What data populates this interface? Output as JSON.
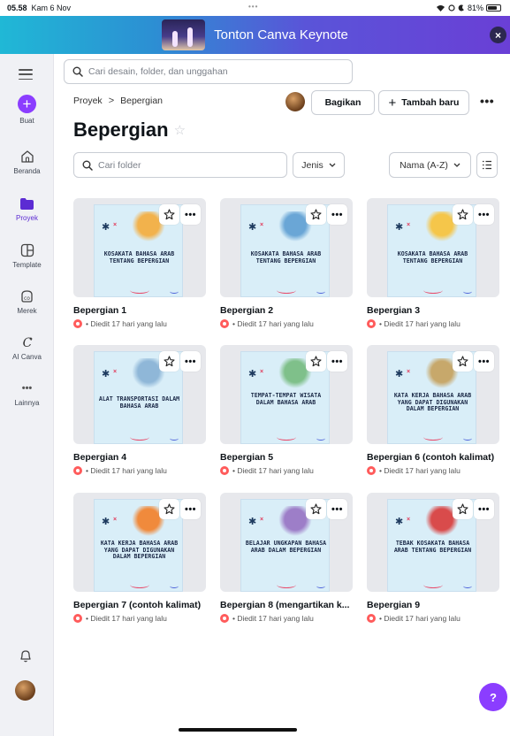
{
  "status": {
    "time": "05.58",
    "date": "Kam 6 Nov",
    "battery": "81%"
  },
  "banner": {
    "title": "Tonton Canva Keynote",
    "close": "×"
  },
  "sidebar": {
    "items": [
      {
        "label": "Buat"
      },
      {
        "label": "Beranda"
      },
      {
        "label": "Proyek"
      },
      {
        "label": "Template"
      },
      {
        "label": "Merek"
      },
      {
        "label": "AI Canva"
      },
      {
        "label": "Lainnya"
      }
    ]
  },
  "search": {
    "placeholder": "Cari desain, folder, dan unggahan"
  },
  "breadcrumb": {
    "root": "Proyek",
    "separator": ">",
    "current": "Bepergian"
  },
  "actions": {
    "share": "Bagikan",
    "new": "Tambah baru",
    "more": "•••"
  },
  "page": {
    "title": "Bepergian"
  },
  "filters": {
    "folder_search_placeholder": "Cari folder",
    "type": "Jenis",
    "sort": "Nama (A-Z)"
  },
  "cards": [
    {
      "name": "Bepergian 1",
      "meta": "• Diedit 17 hari yang lalu",
      "poster": "KOSAKATA BAHASA ARAB TENTANG BEPERGIAN"
    },
    {
      "name": "Bepergian 2",
      "meta": "• Diedit 17 hari yang lalu",
      "poster": "KOSAKATA BAHASA ARAB TENTANG BEPERGIAN"
    },
    {
      "name": "Bepergian 3",
      "meta": "• Diedit 17 hari yang lalu",
      "poster": "KOSAKATA BAHASA ARAB TENTANG BEPERGIAN"
    },
    {
      "name": "Bepergian 4",
      "meta": "• Diedit 17 hari yang lalu",
      "poster": "ALAT TRANSPORTASI DALAM BAHASA ARAB"
    },
    {
      "name": "Bepergian 5",
      "meta": "• Diedit 17 hari yang lalu",
      "poster": "TEMPAT-TEMPAT WISATA DALAM BAHASA ARAB"
    },
    {
      "name": "Bepergian 6 (contoh kalimat)",
      "meta": "• Diedit 17 hari yang lalu",
      "poster": "KATA KERJA BAHASA ARAB YANG DAPAT DIGUNAKAN DALAM BEPERGIAN"
    },
    {
      "name": "Bepergian 7 (contoh kalimat)",
      "meta": "• Diedit 17 hari yang lalu",
      "poster": "KATA KERJA BAHASA ARAB YANG DAPAT DIGUNAKAN DALAM BEPERGIAN"
    },
    {
      "name": "Bepergian 8 (mengartikan k...",
      "meta": "• Diedit 17 hari yang lalu",
      "poster": "BELAJAR UNGKAPAN BAHASA ARAB DALAM BEPERGIAN"
    },
    {
      "name": "Bepergian 9",
      "meta": "• Diedit 17 hari yang lalu",
      "poster": "TEBAK KOSAKATA BAHASA ARAB TENTANG BEPERGIAN"
    }
  ],
  "help": "?",
  "colors": {
    "accent": "#8b3dff",
    "banner_start": "#20b8d6",
    "banner_end": "#6a3fd6"
  }
}
